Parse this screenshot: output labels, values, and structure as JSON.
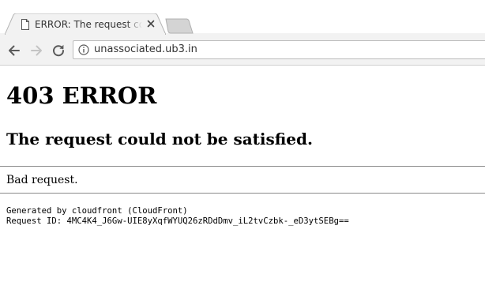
{
  "tab": {
    "title": "ERROR: The request could not be satisfied",
    "favicon_icon": "document-icon",
    "close_icon": "close-icon"
  },
  "new_tab": {
    "icon": "new-tab-icon"
  },
  "toolbar": {
    "back_icon": "arrow-left-icon",
    "forward_icon": "arrow-right-icon",
    "reload_icon": "reload-icon",
    "info_icon": "info-icon",
    "url": "unassociated.ub3.in"
  },
  "page": {
    "heading": "403 ERROR",
    "subheading": "The request could not be satisfied.",
    "message": "Bad request.",
    "generated_by": "Generated by cloudfront (CloudFront)",
    "request_id": "Request ID: 4MC4K4_J6Gw-UIE8yXqfWYUQ26zRDdDmv_iL2tvCzbk-_eD3ytSEBg=="
  },
  "colors": {
    "toolbar_bg": "#f2f2f2",
    "icon_dark": "#5a5a5a",
    "icon_disabled": "#c4c4c4",
    "rule": "#8a8a8a"
  }
}
